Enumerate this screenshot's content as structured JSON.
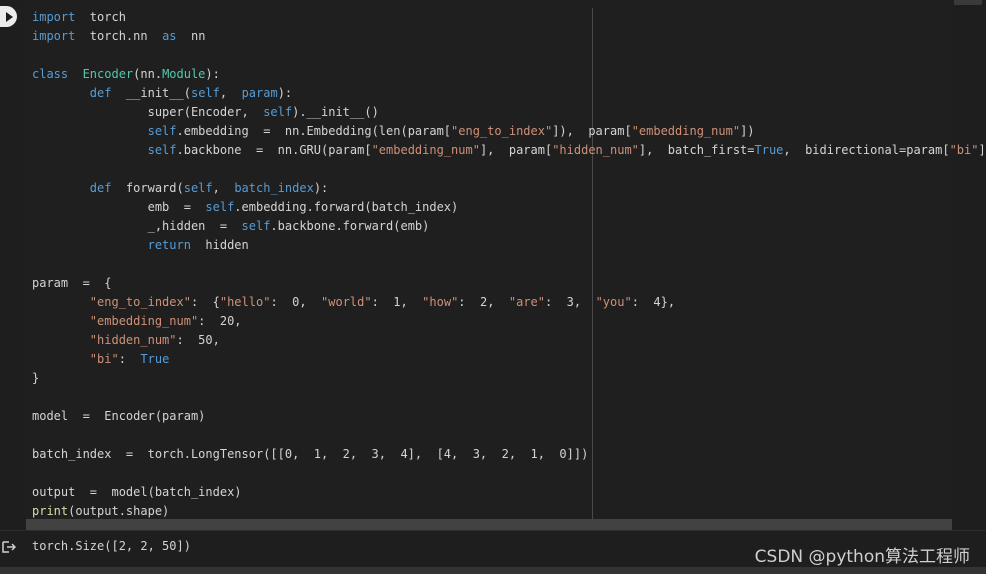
{
  "cell": {
    "code_lines": [
      [
        {
          "t": "import",
          "c": "kw"
        },
        {
          "t": "  torch"
        }
      ],
      [
        {
          "t": "import",
          "c": "kw"
        },
        {
          "t": "  torch.nn  "
        },
        {
          "t": "as",
          "c": "kw"
        },
        {
          "t": "  nn"
        }
      ],
      [],
      [
        {
          "t": "class",
          "c": "kw"
        },
        {
          "t": "  "
        },
        {
          "t": "Encoder",
          "c": "cls"
        },
        {
          "t": "(nn."
        },
        {
          "t": "Module",
          "c": "cls"
        },
        {
          "t": "):"
        }
      ],
      [
        {
          "t": "        "
        },
        {
          "t": "def",
          "c": "kw"
        },
        {
          "t": "  __init__("
        },
        {
          "t": "self",
          "c": "kw"
        },
        {
          "t": ",  "
        },
        {
          "t": "param",
          "c": "kw"
        },
        {
          "t": "):"
        }
      ],
      [
        {
          "t": "                super(Encoder,  "
        },
        {
          "t": "self",
          "c": "kw"
        },
        {
          "t": ").__init__()"
        }
      ],
      [
        {
          "t": "                "
        },
        {
          "t": "self",
          "c": "kw"
        },
        {
          "t": ".embedding  =  nn.Embedding(len(param["
        },
        {
          "t": "\"eng_to_index\"",
          "c": "str"
        },
        {
          "t": "]),  param["
        },
        {
          "t": "\"embedding_num\"",
          "c": "str"
        },
        {
          "t": "])"
        }
      ],
      [
        {
          "t": "                "
        },
        {
          "t": "self",
          "c": "kw"
        },
        {
          "t": ".backbone  =  nn.GRU(param["
        },
        {
          "t": "\"embedding_num\"",
          "c": "str"
        },
        {
          "t": "],  param["
        },
        {
          "t": "\"hidden_num\"",
          "c": "str"
        },
        {
          "t": "],  batch_first="
        },
        {
          "t": "True",
          "c": "kw"
        },
        {
          "t": ",  bidirectional=param["
        },
        {
          "t": "\"bi\"",
          "c": "str"
        },
        {
          "t": "])"
        }
      ],
      [],
      [
        {
          "t": "        "
        },
        {
          "t": "def",
          "c": "kw"
        },
        {
          "t": "  forward("
        },
        {
          "t": "self",
          "c": "kw"
        },
        {
          "t": ",  "
        },
        {
          "t": "batch_index",
          "c": "kw"
        },
        {
          "t": "):"
        }
      ],
      [
        {
          "t": "                emb  =  "
        },
        {
          "t": "self",
          "c": "kw"
        },
        {
          "t": ".embedding.forward(batch_index)"
        }
      ],
      [
        {
          "t": "                _,hidden  =  "
        },
        {
          "t": "self",
          "c": "kw"
        },
        {
          "t": ".backbone.forward(emb)"
        }
      ],
      [
        {
          "t": "                "
        },
        {
          "t": "return",
          "c": "kw"
        },
        {
          "t": "  hidden"
        }
      ],
      [],
      [
        {
          "t": "param  =  {"
        }
      ],
      [
        {
          "t": "        "
        },
        {
          "t": "\"eng_to_index\"",
          "c": "str"
        },
        {
          "t": ":  {"
        },
        {
          "t": "\"hello\"",
          "c": "str"
        },
        {
          "t": ":  0,  "
        },
        {
          "t": "\"world\"",
          "c": "str"
        },
        {
          "t": ":  1,  "
        },
        {
          "t": "\"how\"",
          "c": "str"
        },
        {
          "t": ":  2,  "
        },
        {
          "t": "\"are\"",
          "c": "str"
        },
        {
          "t": ":  3,  "
        },
        {
          "t": "\"you\"",
          "c": "str"
        },
        {
          "t": ":  4},"
        }
      ],
      [
        {
          "t": "        "
        },
        {
          "t": "\"embedding_num\"",
          "c": "str"
        },
        {
          "t": ":  20,"
        }
      ],
      [
        {
          "t": "        "
        },
        {
          "t": "\"hidden_num\"",
          "c": "str"
        },
        {
          "t": ":  50,"
        }
      ],
      [
        {
          "t": "        "
        },
        {
          "t": "\"bi\"",
          "c": "str"
        },
        {
          "t": ":  "
        },
        {
          "t": "True",
          "c": "kw"
        }
      ],
      [
        {
          "t": "}"
        }
      ],
      [],
      [
        {
          "t": "model  =  Encoder(param)"
        }
      ],
      [],
      [
        {
          "t": "batch_index  =  torch.LongTensor([[0,  1,  2,  3,  4],  [4,  3,  2,  1,  0]])"
        }
      ],
      [],
      [
        {
          "t": "output  =  model(batch_index)"
        }
      ],
      [
        {
          "t": "print",
          "c": "builtin"
        },
        {
          "t": "(output.shape)"
        }
      ]
    ]
  },
  "output": {
    "text": "torch.Size([2, 2, 50])"
  },
  "watermark": "CSDN @python算法工程师",
  "icons": {
    "run": "play-icon",
    "output": "output-arrow-icon"
  },
  "colors": {
    "background": "#1e1e1e",
    "keyword": "#569cd6",
    "string": "#ce9178",
    "class": "#4ec9b0",
    "text": "#d4d4d4"
  }
}
